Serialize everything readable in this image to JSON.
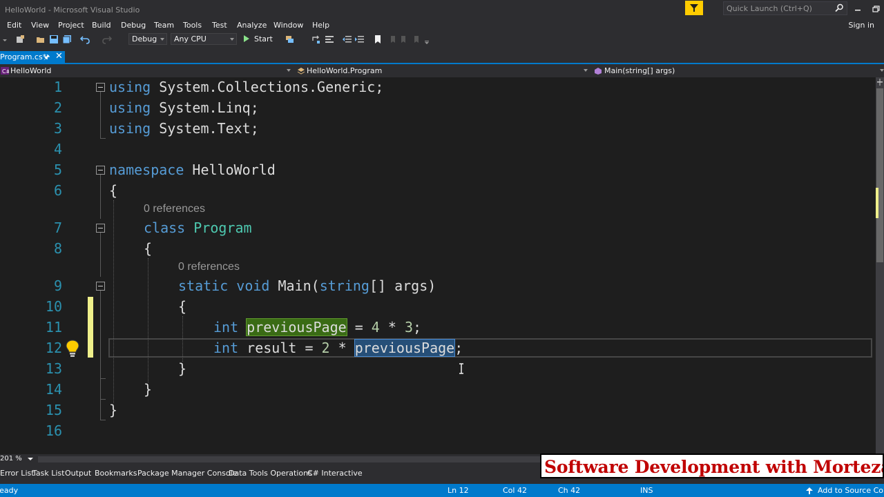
{
  "window": {
    "title": "HelloWorld - Microsoft Visual Studio",
    "quick_launch_placeholder": "Quick Launch (Ctrl+Q)",
    "sign_in": "Sign in"
  },
  "menu": {
    "items": [
      "Edit",
      "View",
      "Project",
      "Build",
      "Debug",
      "Team",
      "Tools",
      "Test",
      "Analyze",
      "Window",
      "Help"
    ]
  },
  "toolbar": {
    "configuration": "Debug",
    "platform": "Any CPU",
    "start_label": "Start"
  },
  "tabs": {
    "active": "Program.cs*"
  },
  "navbar": {
    "project": "HelloWorld",
    "class": "HelloWorld.Program",
    "member": "Main(string[] args)"
  },
  "editor": {
    "line_numbers": [
      "1",
      "2",
      "3",
      "4",
      "5",
      "6",
      "7",
      "8",
      "9",
      "10",
      "11",
      "12",
      "13",
      "14",
      "15",
      "16"
    ],
    "codelens": [
      "0 references",
      "0 references"
    ],
    "tokens": {
      "using": "using",
      "ns1": " System.Collections.Generic;",
      "ns2": " System.Linq;",
      "ns3": " System.Text;",
      "namespace_kw": "namespace",
      "namespace_name": " HelloWorld",
      "open_brace": "{",
      "close_brace": "}",
      "class_kw": "class",
      "class_name": "Program",
      "static_kw": "static",
      "void_kw": "void",
      "main": " Main(",
      "string_kw": "string",
      "args": "[] args)",
      "int_kw": "int",
      "var_prev": "previousPage",
      "assign1": " = ",
      "four": "4",
      "times": " * ",
      "three": "3",
      "semi": ";",
      "result": " result = ",
      "two": "2"
    }
  },
  "zoom": "201 %",
  "tool_windows": [
    "Error List",
    "Task List",
    "Output",
    "Bookmarks",
    "Package Manager Console",
    "Data Tools Operations",
    "C# Interactive"
  ],
  "watermark": "Software Development with Morteza",
  "status": {
    "state": "Ready",
    "line": "Ln 12",
    "col": "Col 42",
    "ch": "Ch 42",
    "mode": "INS",
    "source_control": "Add to Source Control"
  },
  "colors": {
    "accent": "#007acc",
    "keyword": "#569cd6",
    "type": "#4ec9b0",
    "number": "#b5cea8",
    "line_number": "#2b91af",
    "definition_highlight": "#3a6b15",
    "reference_highlight": "#264f78",
    "change_marker": "#eff08b"
  }
}
